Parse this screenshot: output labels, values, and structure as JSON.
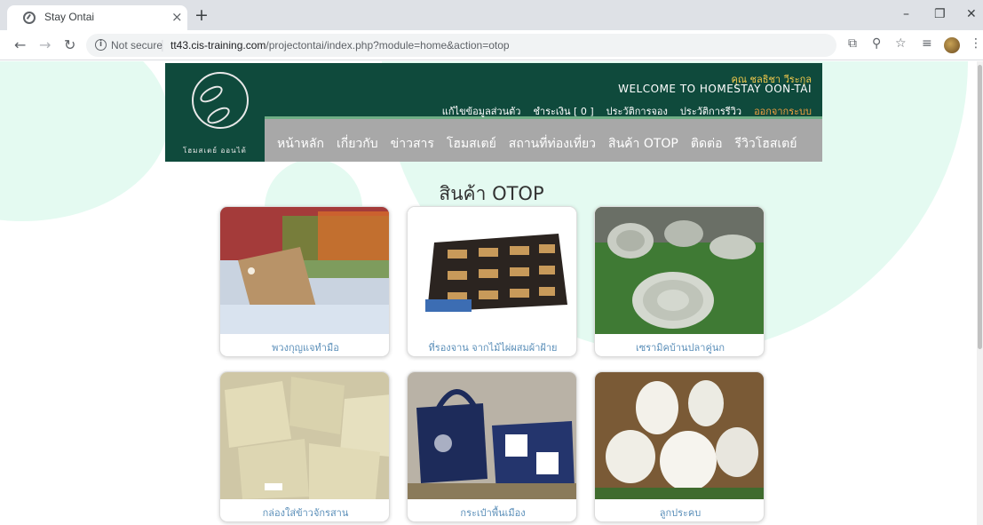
{
  "browser": {
    "tab_title": "Stay Ontai",
    "tab_close": "×",
    "new_tab": "+",
    "not_secure": "Not secure",
    "url_host": "tt43.cis-training.com",
    "url_path": "/projectontai/index.php?module=home&action=otop",
    "window_controls": {
      "minimize": "–",
      "restore": "❐",
      "close": "✕"
    }
  },
  "site": {
    "logo_text": "โฮมสเตย์ ออนไต้",
    "user_name": "คุณ ชลธิชา วีระกุล",
    "welcome": "WELCOME TO HOMESTAY OON-TAI",
    "user_links": [
      "แก้ไขข้อมูลส่วนตัว",
      "ชำระเงิน [ 0 ]",
      "ประวัติการจอง",
      "ประวัติการรีวิว",
      "ออกจากระบบ"
    ],
    "nav": [
      "หน้าหลัก",
      "เกี่ยวกับ",
      "ข่าวสาร",
      "โฮมสเตย์",
      "สถานที่ท่องเที่ยว",
      "สินค้า OTOP",
      "ติดต่อ",
      "รีวิวโฮสเตย์"
    ]
  },
  "page": {
    "heading": "สินค้า OTOP",
    "products": [
      {
        "label": "พวงกุญแจทำมือ"
      },
      {
        "label": "ที่รองจาน จากไม้ไผ่ผสมผ้าฝ้าย"
      },
      {
        "label": "เซรามิคบ้านปลาคู่นก"
      },
      {
        "label": "กล่องใส่ข้าวจักรสาน"
      },
      {
        "label": "กระเป๋าพื้นเมือง"
      },
      {
        "label": "ลูกประคบ"
      }
    ]
  },
  "colors": {
    "header_green": "#0f4a3c",
    "nav_gray": "#a8a8a8",
    "accent_yellow": "#f2c94c",
    "logout_orange": "#f0a040",
    "label_blue": "#5b8fb9",
    "bg_mint": "#e4faf1"
  }
}
